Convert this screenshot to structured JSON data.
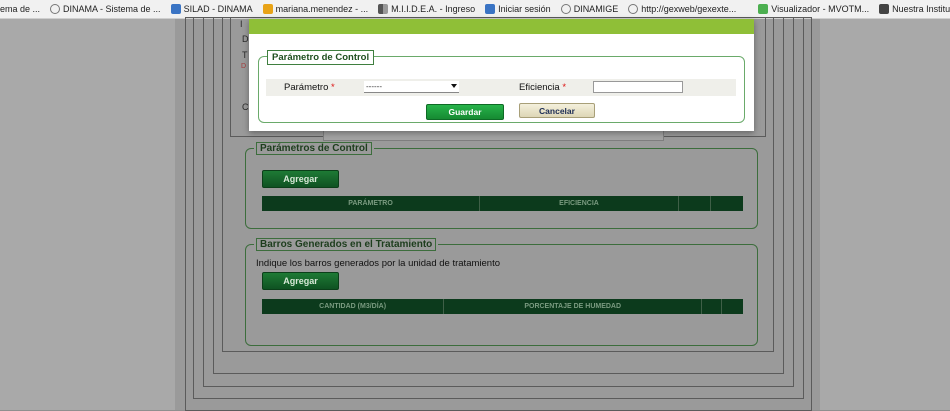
{
  "bookmarks": [
    {
      "label": "ema de ...",
      "icon": "none"
    },
    {
      "label": "DINAMA - Sistema de ...",
      "icon": "globe-icon"
    },
    {
      "label": "SILAD - DINAMA",
      "icon": "silad-icon"
    },
    {
      "label": "mariana.menendez - ...",
      "icon": "office-icon"
    },
    {
      "label": "M.I.I.D.E.A. - Ingreso",
      "icon": "miidea-icon"
    },
    {
      "label": "Iniciar sesión",
      "icon": "windows-icon"
    },
    {
      "label": "DINAMIGE",
      "icon": "globe-icon"
    },
    {
      "label": "http://gexweb/gexexte...",
      "icon": "globe-icon"
    },
    {
      "label": "Visualizador - MVOTM...",
      "icon": "visualizer-icon"
    },
    {
      "label": "Nuestra Institución",
      "icon": "institution-icon"
    }
  ],
  "modal": {
    "legend": "Parámetro de Control",
    "parametro_label": "Parámetro",
    "required_mark": "*",
    "parametro_value": "------",
    "eficiencia_label": "Eficiencia",
    "eficiencia_value": "",
    "save_label": "Guardar",
    "cancel_label": "Cancelar"
  },
  "background_form": {
    "parametros": {
      "legend": "Parámetros de Control",
      "add_label": "Agregar",
      "columns": [
        "PARÁMETRO",
        "EFICIENCIA"
      ]
    },
    "barros": {
      "legend": "Barros Generados en el Tratamiento",
      "instruction": "Indique los barros generados por la unidad de tratamiento",
      "add_label": "Agregar",
      "columns": [
        "CANTIDAD (M3/DÍA)",
        "PORCENTAJE DE HUMEDAD"
      ]
    },
    "ghost_letters": [
      "I",
      "D",
      "T",
      "D",
      "C"
    ]
  },
  "colors": {
    "overlay": "#8f8f8f",
    "modal_bar": "#8fbf37",
    "green_button": "#168a32",
    "table_header": "#0c3a1c"
  }
}
